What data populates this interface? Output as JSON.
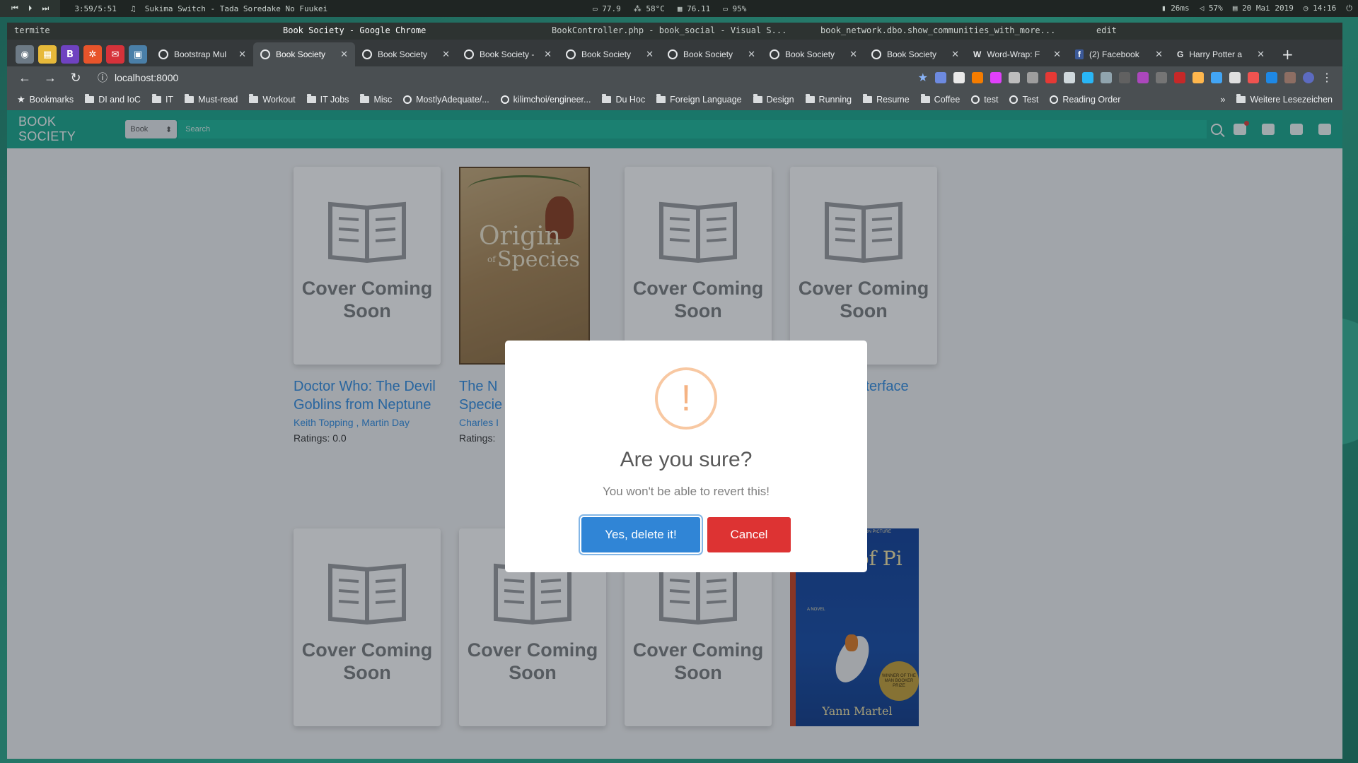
{
  "statusbar": {
    "media_time": "3:59/5:51",
    "track": "♫  Sukima Switch - Tada Soredake No Fuukei",
    "cpu": "77.9",
    "temp": "58°C",
    "mem": "76.11",
    "battery_left": "95%",
    "net": "26ms",
    "volume": "57%",
    "date": "20 Mai 2019",
    "time": "14:16"
  },
  "window_titles": [
    "termite",
    "Book Society - Google Chrome",
    "BookController.php - book_social - Visual S...",
    "book_network.dbo.show_communities_with_more...",
    "edit"
  ],
  "tabs": [
    {
      "label": "Bootstrap Mul"
    },
    {
      "label": "Book Society"
    },
    {
      "label": "Book Society"
    },
    {
      "label": "Book Society -"
    },
    {
      "label": "Book Society"
    },
    {
      "label": "Book Society"
    },
    {
      "label": "Book Society"
    },
    {
      "label": "Book Society"
    },
    {
      "label": "Word-Wrap: F"
    },
    {
      "label": "(2) Facebook"
    },
    {
      "label": "Harry Potter a"
    }
  ],
  "address": {
    "url": "localhost:8000"
  },
  "bookmarks": [
    "Bookmarks",
    "DI and IoC",
    "IT",
    "Must-read",
    "Workout",
    "IT Jobs",
    "Misc",
    "MostlyAdequate/...",
    "kilimchoi/engineer...",
    "Du Hoc",
    "Foreign Language",
    "Design",
    "Running",
    "Resume",
    "Coffee",
    "test",
    "Test",
    "Reading Order"
  ],
  "bookmarks_other": "Weitere Lesezeichen",
  "app": {
    "brand": "BOOK SOCIETY",
    "select_value": "Book",
    "search_placeholder": "Search"
  },
  "books": [
    {
      "cover": "Cover Coming Soon",
      "title": "Doctor Who: The Devil Goblins from Neptune",
      "author1": "Keith Topping",
      "sep": ",",
      "author2": "Martin Day",
      "rating": "Ratings: 0.0"
    },
    {
      "cover_title_1": "Origin",
      "cover_of": "of",
      "cover_title_2": "Species",
      "title": "The N",
      "title2": "Specie",
      "author1": "Charles I",
      "rating": "Ratings:"
    },
    {
      "cover": "Cover Coming Soon"
    },
    {
      "cover": "Cover Coming Soon",
      "title": "he Interface"
    },
    {
      "cover": "Cover Coming Soon"
    },
    {
      "cover": "Cover Coming Soon"
    },
    {
      "cover": "Cover Coming Soon"
    },
    {
      "cover_top": "NOW A MAJOR MOTION PICTURE",
      "cover_title": "Life of Pi",
      "cover_novel": "A NOVEL",
      "cover_seal": "WINNER OF THE MAN BOOKER PRIZE",
      "cover_author": "Yann Martel"
    }
  ],
  "dialog": {
    "icon": "!",
    "title": "Are you sure?",
    "text": "You won't be able to revert this!",
    "confirm": "Yes, delete it!",
    "cancel": "Cancel"
  },
  "colors": {
    "navbar": "#17a88d",
    "link": "#2f8de4",
    "confirm": "#3085d6",
    "cancel": "#dd3333",
    "warning_icon": "#f8bb86"
  }
}
